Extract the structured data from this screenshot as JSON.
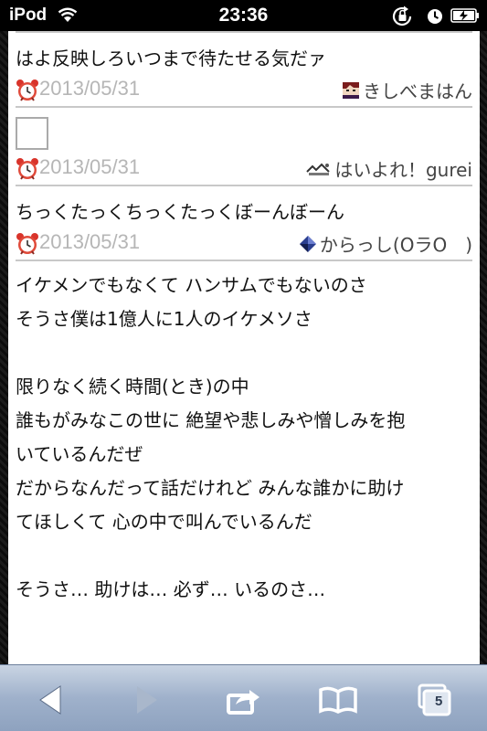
{
  "status_bar": {
    "carrier": "iPod",
    "time": "23:36"
  },
  "entries": [
    {
      "text": "はよ反映しろいつまで待たせる気だァ",
      "date": "2013/05/31",
      "author": "きしべまはん"
    },
    {
      "text": "",
      "date": "2013/05/31",
      "author": "はいよれ！gurei"
    },
    {
      "text": "ちっくたっくちっくたっくぼーんぼーん",
      "date": "2013/05/31",
      "author": "からっし(ΟラΟ　)"
    }
  ],
  "post": {
    "lines": [
      "イケメンでもなくて ハンサムでもないのさ",
      "そうさ僕は1億人に1人のイケメソさ",
      "",
      "限りなく続く時間(とき)の中",
      "誰もがみなこの世に 絶望や悲しみや憎しみを抱",
      "いているんだぜ",
      "だからなんだって話だけれど みんな誰かに助け",
      "てほしくて 心の中で叫んでいるんだ",
      "",
      "そうさ… 助けは… 必ず… いるのさ…"
    ]
  },
  "toolbar": {
    "tabs_count": "5"
  },
  "colors": {
    "toolbar_icon": "#4a5a72",
    "date_gray": "#b6b6b6"
  }
}
